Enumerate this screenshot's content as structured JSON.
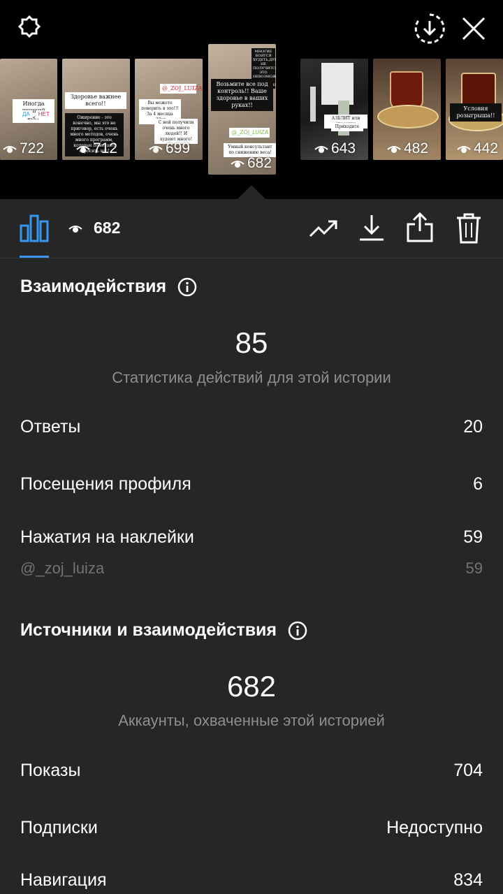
{
  "thumbnails": [
    {
      "views": "722",
      "caption": "Иногда лишний вес?",
      "btn_yes": "ДА",
      "btn_no": "НЕТ"
    },
    {
      "views": "712",
      "caption": "Здоровье важнее всего!!",
      "caption2": "Ожирение - это конечно, мы это не приговор, есть очень много методов, очень много программ, которые помогают сбросить вес!"
    },
    {
      "views": "699",
      "caption": "@_ZOJ_LUIZA",
      "caption2": "Вы можете поверить в это!!! За 4 месяца -32кг",
      "caption3": "С ней получили очень много людей!! И худеют много!"
    },
    {
      "views": "682",
      "caption": "МНОГИЕ БОЯТСЯ ХУДЕТЬ,ДУМАЯ,ЧТО НЕ ПОЛУЧИТСЯ,ЧТО ЭТО НЕВОЗМОЖНО,НО ВЫ ОШИБАЕТЕСЬ",
      "caption2": "Возьмите все под контроль!! Ваше здоровье в ваших руках!!",
      "caption3": "@_ZOJ_LUIZA",
      "caption4": "Умный консультант по снижению веса!"
    },
    {
      "views": "643",
      "caption": "АЗБЛИТ или спасение",
      "caption2": "Приходите"
    },
    {
      "views": "482"
    },
    {
      "views": "442",
      "caption": "Условия розыгрыша!!"
    }
  ],
  "toolbar": {
    "views": "682"
  },
  "interactions": {
    "title": "Взаимодействия",
    "total": "85",
    "subtitle": "Статистика действий для этой истории",
    "rows": [
      {
        "label": "Ответы",
        "value": "20"
      },
      {
        "label": "Посещения профиля",
        "value": "6"
      },
      {
        "label": "Нажатия на наклейки",
        "value": "59"
      }
    ],
    "sub_row": {
      "label": "@_zoj_luiza",
      "value": "59"
    }
  },
  "sources": {
    "title": "Источники и взаимодействия",
    "total": "682",
    "subtitle": "Аккаунты, охваченные этой историей",
    "rows": [
      {
        "label": "Показы",
        "value": "704"
      },
      {
        "label": "Подписки",
        "value": "Недоступно"
      },
      {
        "label": "Навигация",
        "value": "834"
      }
    ]
  },
  "colors": {
    "accent": "#3897f0",
    "background": "#262626",
    "top_background": "#000000",
    "muted": "#8e8e8e"
  }
}
